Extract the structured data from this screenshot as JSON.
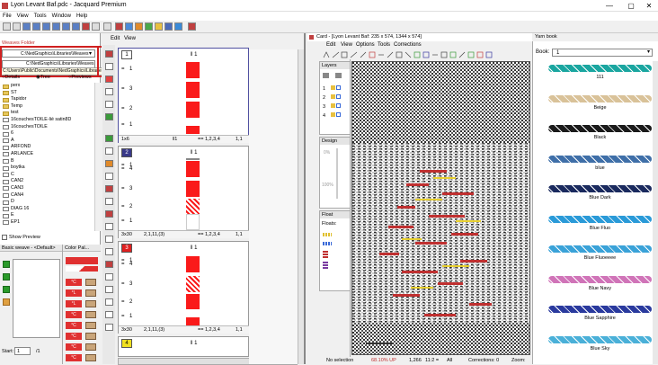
{
  "window": {
    "title": "Lyon Levant Baf.pdc - Jacquard Premium",
    "minimize": "—",
    "maximize": "▢",
    "close": "✕"
  },
  "menu": [
    "File",
    "View",
    "Tools",
    "Window",
    "Help"
  ],
  "left_panel": {
    "weaves_folder_label": "Weaves Folder",
    "path_combo": "C:\\NedGraphics\\Libraries\\Weaves",
    "path_field": "C:\\NedGraphics\\Libraries\\Weaves",
    "path_tooltip": "C:\\Users\\Public\\Documents\\NedGraphics\\Libraries\\Weaves",
    "view_options": [
      "Details",
      "Tree",
      "Previews"
    ],
    "tree_items": [
      "perx",
      "ST",
      "Tapidor",
      "Temp",
      "test",
      "16couchesTOILE-lié satin8D",
      "16couchesTOILE",
      "6",
      "A",
      "ARFOND",
      "ARLANCE",
      "B",
      "boytka",
      "C",
      "CAN2",
      "CAN3",
      "CAN4",
      "D",
      "DIAG 16",
      "E",
      "EP1"
    ],
    "show_preview": "Show Preview"
  },
  "basic_weave": {
    "title": "Basic weave - <Default>",
    "start_label": "Start:",
    "start_value": "1",
    "of_label": "/1"
  },
  "color_palette": {
    "title": "Color Pal...",
    "labels": [
      "°C",
      "°L",
      "°L",
      "°C",
      "°C",
      "°C",
      "°C",
      "°C",
      "°C"
    ]
  },
  "middle_panel": {
    "menu": [
      "Edit",
      "View"
    ],
    "blocks": [
      {
        "number": "1",
        "header_val": "1",
        "rows": [
          "1",
          "3",
          "2",
          "1"
        ],
        "footer": [
          "1x6",
          "1",
          "== 1,2,3,4",
          "1,1"
        ]
      },
      {
        "number": "2",
        "header_val": "1",
        "rows": [
          "1",
          "4",
          "3",
          "2",
          "1"
        ],
        "footer": [
          "3x30",
          "2,1,11,(3)",
          "== 1,2,3,4",
          "1,1"
        ]
      },
      {
        "number": "3",
        "header_val": "1",
        "rows": [
          "1",
          "4",
          "3",
          "2",
          "1"
        ],
        "footer": [
          "3x30",
          "2,1,11,(3)",
          "== 1,2,3,4",
          "1,1"
        ]
      },
      {
        "number": "4",
        "header_val": "1",
        "rows": [],
        "footer": []
      }
    ]
  },
  "card": {
    "title": "Card - [Lyon Levant Baf: 235 x 574, 1344 x 574]",
    "menu": [
      "Edit",
      "View",
      "Options",
      "Tools",
      "Corrections"
    ],
    "layers_title": "Layers",
    "layers": [
      "1",
      "2",
      "3",
      "4"
    ],
    "design_title": "Design",
    "zoom_labels": [
      "0%",
      "100%"
    ],
    "float_title": "Float",
    "floats_label": "Floats:",
    "status": [
      "No selection",
      "68.10% UP",
      "1,266",
      "11:2 =",
      "All",
      "Corrections: 0",
      "Zoom:"
    ]
  },
  "yarn_book": {
    "title": "Yarn book",
    "book_label": "Book:",
    "book_value": "1",
    "yarns": [
      {
        "name": "111",
        "color": "#1aa6a0"
      },
      {
        "name": "Beige",
        "color": "#d9c299"
      },
      {
        "name": "Black",
        "color": "#1a1a1a"
      },
      {
        "name": "blue",
        "color": "#3f6fa8"
      },
      {
        "name": "Blue Dark",
        "color": "#1a2a5e"
      },
      {
        "name": "Blue Fluo",
        "color": "#2a9ad8"
      },
      {
        "name": "Blue Fluoeeee",
        "color": "#3aa2d8"
      },
      {
        "name": "Blue Navy",
        "color": "#d074b8"
      },
      {
        "name": "Blue Sapphire",
        "color": "#2a3a9e"
      },
      {
        "name": "Blue Sky",
        "color": "#4ab0d8"
      }
    ]
  }
}
